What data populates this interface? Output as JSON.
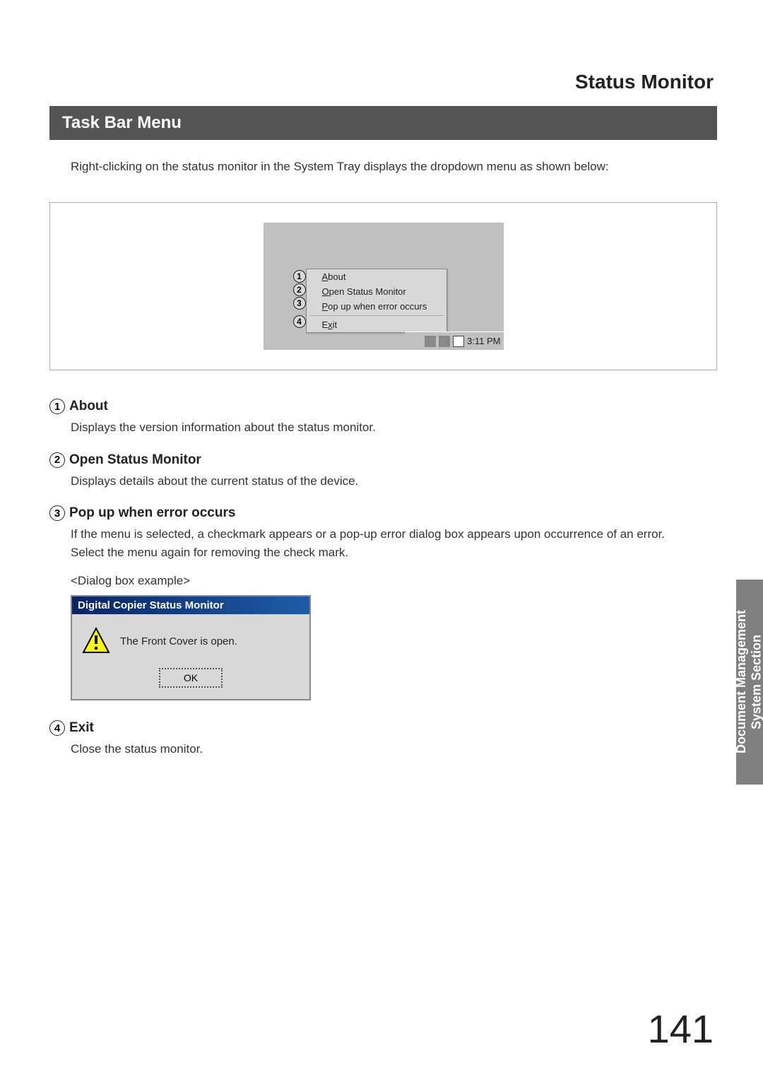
{
  "chapter_title": "Status Monitor",
  "section_header": "Task Bar Menu",
  "intro": "Right-clicking on the status monitor in the System Tray displays the dropdown menu as shown below:",
  "menu": {
    "items": [
      {
        "num": "1",
        "label": "About"
      },
      {
        "num": "2",
        "label": "Open Status Monitor"
      },
      {
        "num": "3",
        "label": "Pop up when error occurs"
      },
      {
        "num": "4",
        "label": "Exit"
      }
    ],
    "time": "3:11 PM"
  },
  "descriptions": [
    {
      "num": "1",
      "title": "About",
      "text": "Displays the version information about the status monitor."
    },
    {
      "num": "2",
      "title": "Open Status Monitor",
      "text": "Displays details about the current status of the device."
    },
    {
      "num": "3",
      "title": "Pop up when error occurs",
      "text": "If the menu is selected, a checkmark appears or a pop-up error dialog box appears upon occurrence of an error.\nSelect the menu again for removing the check mark."
    },
    {
      "num": "4",
      "title": "Exit",
      "text": "Close the status monitor."
    }
  ],
  "example_label": "<Dialog box example>",
  "dialog": {
    "title": "Digital Copier Status Monitor",
    "message": "The Front Cover is open.",
    "ok": "OK"
  },
  "side_tab": "Document Management\nSystem Section",
  "page_number": "141"
}
